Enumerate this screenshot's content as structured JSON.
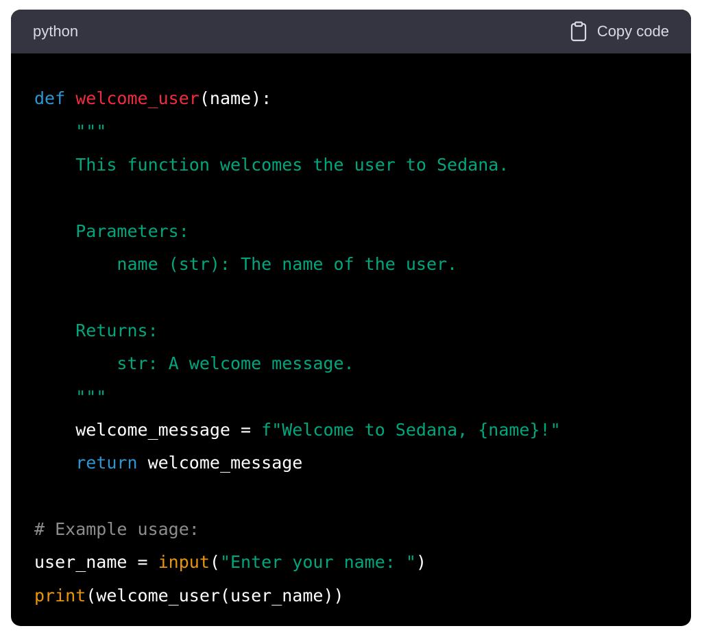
{
  "header": {
    "language": "python",
    "copy_label": "Copy code",
    "copy_icon": "clipboard-icon"
  },
  "colors": {
    "keyword": "#2e95d3",
    "function_name": "#f22c3d",
    "string": "#00a67d",
    "builtin": "#e9950c",
    "comment": "#8d8d8d",
    "plain": "#ffffff",
    "header_bg": "#343541",
    "code_bg": "#000000"
  },
  "code": {
    "lines": [
      [
        {
          "t": "def",
          "k": "kw"
        },
        {
          "t": " ",
          "k": "plain"
        },
        {
          "t": "welcome_user",
          "k": "fn"
        },
        {
          "t": "(name):",
          "k": "plain"
        }
      ],
      [
        {
          "t": "    \"\"\"",
          "k": "str"
        }
      ],
      [
        {
          "t": "    This function welcomes the user to Sedana.",
          "k": "str"
        }
      ],
      [],
      [
        {
          "t": "    Parameters:",
          "k": "str"
        }
      ],
      [
        {
          "t": "        name (str): The name of the user.",
          "k": "str"
        }
      ],
      [],
      [
        {
          "t": "    Returns:",
          "k": "str"
        }
      ],
      [
        {
          "t": "        str: A welcome message.",
          "k": "str"
        }
      ],
      [
        {
          "t": "    \"\"\"",
          "k": "str"
        }
      ],
      [
        {
          "t": "    welcome_message = ",
          "k": "plain"
        },
        {
          "t": "f\"Welcome to Sedana, {name}!\"",
          "k": "str"
        }
      ],
      [
        {
          "t": "    ",
          "k": "plain"
        },
        {
          "t": "return",
          "k": "kw"
        },
        {
          "t": " welcome_message",
          "k": "plain"
        }
      ],
      [],
      [
        {
          "t": "# Example usage:",
          "k": "comment"
        }
      ],
      [
        {
          "t": "user_name = ",
          "k": "plain"
        },
        {
          "t": "input",
          "k": "builtin"
        },
        {
          "t": "(",
          "k": "plain"
        },
        {
          "t": "\"Enter your name: \"",
          "k": "str"
        },
        {
          "t": ")",
          "k": "plain"
        }
      ],
      [
        {
          "t": "print",
          "k": "builtin"
        },
        {
          "t": "(welcome_user(user_name))",
          "k": "plain"
        }
      ]
    ]
  }
}
